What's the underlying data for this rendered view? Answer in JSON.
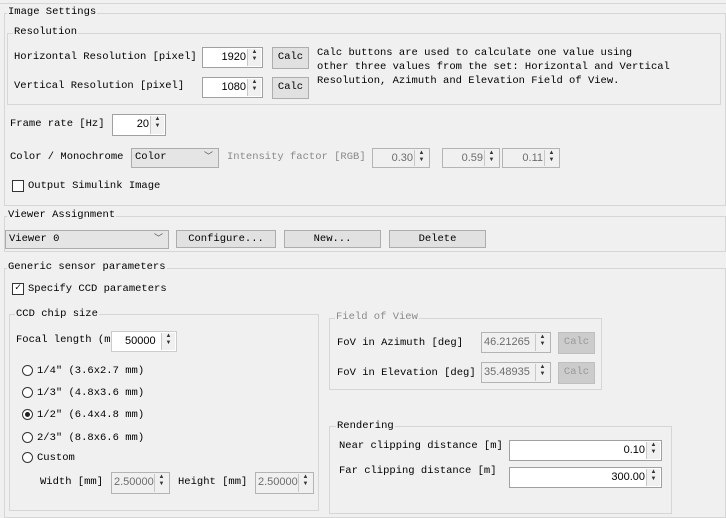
{
  "image_settings": {
    "title": "Image Settings",
    "resolution": {
      "title": "Resolution",
      "h_label": "Horizontal Resolution [pixel]",
      "h_value": "1920",
      "v_label": "Vertical Resolution [pixel]",
      "v_value": "1080",
      "calc_label": "Calc",
      "description": [
        "Calc buttons are used to calculate one value using",
        "other three values from the set: Horizontal and Vertical",
        "Resolution, Azimuth and Elevation Field of View."
      ]
    },
    "frame_rate_label": "Frame rate [Hz]",
    "frame_rate_value": "20",
    "color_label": "Color / Monochrome",
    "color_value": "Color",
    "intensity_label": "Intensity factor [RGB]",
    "intensity_values": [
      "0.30",
      "0.59",
      "0.11"
    ],
    "output_simulink_label": "Output Simulink Image",
    "output_simulink_checked": false
  },
  "viewer": {
    "title": "Viewer Assignment",
    "selected": "Viewer 0",
    "configure_label": "Configure...",
    "new_label": "New...",
    "delete_label": "Delete"
  },
  "generic": {
    "title": "Generic sensor parameters",
    "specify_ccd_label": "Specify CCD parameters",
    "specify_ccd_checked": true,
    "ccd": {
      "title": "CCD chip size",
      "focal_label": "Focal length (mm)",
      "focal_value": "50000",
      "options": [
        "1/4\" (3.6x2.7 mm)",
        "1/3\" (4.8x3.6 mm)",
        "1/2\" (6.4x4.8 mm)",
        "2/3\" (8.8x6.6 mm)",
        "Custom"
      ],
      "selected_index": 2,
      "width_label": "Width [mm]",
      "width_value": "2.50000",
      "height_label": "Height [mm]",
      "height_value": "2.50000"
    },
    "fov": {
      "title": "Field of View",
      "az_label": "FoV in Azimuth [deg]",
      "az_value": "46.21265",
      "el_label": "FoV in Elevation [deg]",
      "el_value": "35.48935",
      "calc_label": "Calc"
    },
    "rendering": {
      "title": "Rendering",
      "near_label": "Near clipping distance [m]",
      "near_value": "0.10",
      "far_label": "Far clipping distance [m]",
      "far_value": "300.00"
    }
  }
}
